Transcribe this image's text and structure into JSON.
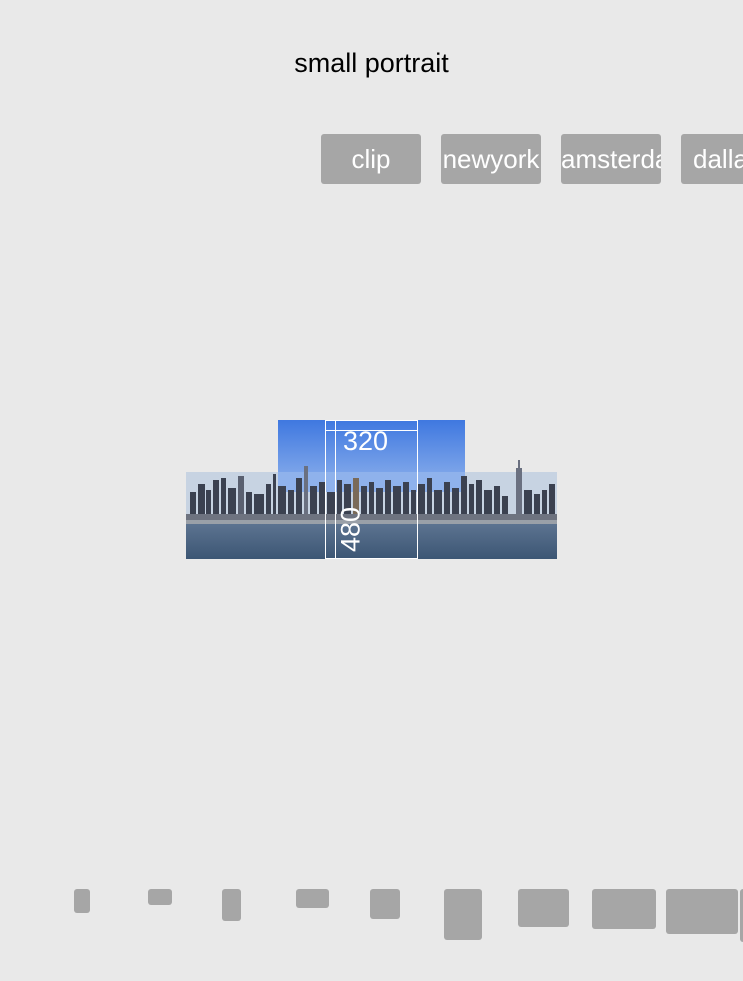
{
  "page": {
    "title": "small portrait"
  },
  "buttons": [
    {
      "label": "clip"
    },
    {
      "label": "newyork"
    },
    {
      "label": "amsterdam"
    },
    {
      "label": "dallas"
    }
  ],
  "preview": {
    "width_label": "320",
    "height_label": "480"
  },
  "colors": {
    "background": "#e9e9e9",
    "button": "#a6a6a6",
    "sky": "#4a86e8"
  }
}
